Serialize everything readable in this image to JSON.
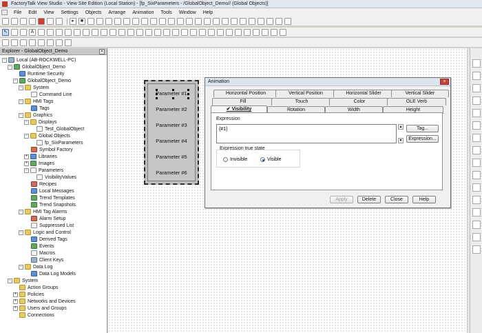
{
  "window": {
    "title": "FactoryTalk View Studio - View Site Edition (Local Station) - [fp_SixParameters - /GlobalObject_Demo// (Global Objects)]"
  },
  "menu": [
    "File",
    "Edit",
    "View",
    "Settings",
    "Objects",
    "Arrange",
    "Animation",
    "Tools",
    "Window",
    "Help"
  ],
  "explorer": {
    "title": "Explorer - GlobalObject_Demo",
    "tree": [
      {
        "label": "Local (AB-ROCKWELL-PC)",
        "icon": "computer-icon"
      },
      {
        "label": "GlobalObject_Demo",
        "icon": "application-icon"
      },
      {
        "label": "Runtime Security",
        "icon": "security-icon"
      },
      {
        "label": "GlobalObject_Demo",
        "icon": "server-icon"
      },
      {
        "label": "System",
        "icon": "folder-icon"
      },
      {
        "label": "Command Line",
        "icon": "command-icon"
      },
      {
        "label": "HMI Tags",
        "icon": "folder-icon"
      },
      {
        "label": "Tags",
        "icon": "tag-icon"
      },
      {
        "label": "Graphics",
        "icon": "folder-icon"
      },
      {
        "label": "Displays",
        "icon": "folder-icon"
      },
      {
        "label": "Test_GlobalObject",
        "icon": "display-icon"
      },
      {
        "label": "Global Objects",
        "icon": "folder-icon"
      },
      {
        "label": "fp_SixParameters",
        "icon": "display-icon"
      },
      {
        "label": "Symbol Factory",
        "icon": "symbol-icon"
      },
      {
        "label": "Libraries",
        "icon": "library-icon"
      },
      {
        "label": "Images",
        "icon": "image-icon"
      },
      {
        "label": "Parameters",
        "icon": "folder-icon"
      },
      {
        "label": "VisibilityValues",
        "icon": "parameter-icon"
      },
      {
        "label": "Recipes",
        "icon": "recipe-icon"
      },
      {
        "label": "Local Messages",
        "icon": "message-icon"
      },
      {
        "label": "Trend Templates",
        "icon": "trend-icon"
      },
      {
        "label": "Trend Snapshots",
        "icon": "trend-icon"
      },
      {
        "label": "HMI Tag Alarms",
        "icon": "folder-icon"
      },
      {
        "label": "Alarm Setup",
        "icon": "alarm-icon"
      },
      {
        "label": "Suppressed List",
        "icon": "list-icon"
      },
      {
        "label": "Logic and Control",
        "icon": "folder-icon"
      },
      {
        "label": "Derived Tags",
        "icon": "tag-icon"
      },
      {
        "label": "Events",
        "icon": "event-icon"
      },
      {
        "label": "Macros",
        "icon": "macro-icon"
      },
      {
        "label": "Client Keys",
        "icon": "key-icon"
      },
      {
        "label": "Data Log",
        "icon": "folder-icon"
      },
      {
        "label": "Data Log Models",
        "icon": "datalog-icon"
      },
      {
        "label": "System",
        "icon": "folder-icon"
      },
      {
        "label": "Action Groups",
        "icon": "folder-icon"
      },
      {
        "label": "Policies",
        "icon": "folder-icon"
      },
      {
        "label": "Networks and Devices",
        "icon": "folder-icon"
      },
      {
        "label": "Users and Groups",
        "icon": "folder-icon"
      },
      {
        "label": "Connections",
        "icon": "folder-icon"
      }
    ]
  },
  "graphic": {
    "parameters": [
      "Parameter #1",
      "Parameter #2",
      "Parameter #3",
      "Parameter #4",
      "Parameter #5",
      "Parameter #6"
    ]
  },
  "dialog": {
    "title": "Animation",
    "tabs_row1": [
      "Horizontal Position",
      "Vertical Position",
      "Horizontal Slider",
      "Vertical Slider"
    ],
    "tabs_row2": [
      "Fill",
      "Touch",
      "Color",
      "OLE Verb"
    ],
    "tabs_row3": [
      "Visibility",
      "Rotation",
      "Width",
      "Height"
    ],
    "active_tab": "Visibility",
    "expression_label": "Expression",
    "expression_value": "{#1}",
    "tag_button": "Tag...",
    "expression_button": "Expression...",
    "true_state_label": "Expression true state",
    "option_invisible": "Invisible",
    "option_visible": "Visible",
    "selected_option": "Visible",
    "apply_button": "Apply",
    "delete_button": "Delete",
    "close_button": "Close",
    "help_button": "Help"
  }
}
